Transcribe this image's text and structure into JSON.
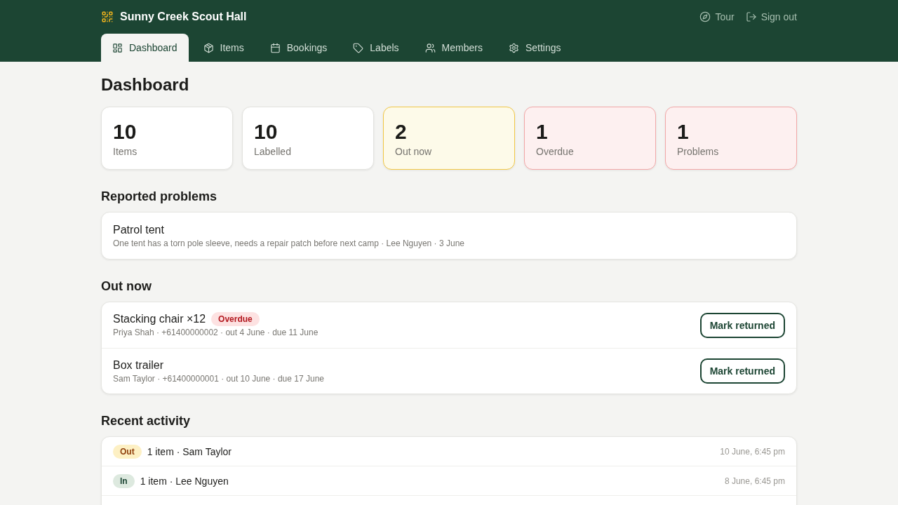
{
  "header": {
    "title": "Sunny Creek Scout Hall",
    "actions": [
      {
        "label": "Tour"
      },
      {
        "label": "Sign out"
      }
    ]
  },
  "tabs": [
    {
      "label": "Dashboard",
      "selected": true
    },
    {
      "label": "Items",
      "selected": false
    },
    {
      "label": "Bookings",
      "selected": false
    },
    {
      "label": "Labels",
      "selected": false
    },
    {
      "label": "Members",
      "selected": false
    },
    {
      "label": "Settings",
      "selected": false
    }
  ],
  "page_title": "Dashboard",
  "stats": [
    {
      "value": "10",
      "label": "Items",
      "kind": "neutral"
    },
    {
      "value": "10",
      "label": "Labelled",
      "kind": "neutral"
    },
    {
      "value": "2",
      "label": "Out now",
      "kind": "warning"
    },
    {
      "value": "1",
      "label": "Overdue",
      "kind": "alert"
    },
    {
      "value": "1",
      "label": "Problems",
      "kind": "alert"
    }
  ],
  "problems": {
    "heading": "Reported problems",
    "items": [
      {
        "title": "Patrol tent",
        "detail": "One tent has a torn pole sleeve, needs a repair patch before next camp · Lee Nguyen · 3 June"
      }
    ]
  },
  "out_now": {
    "heading": "Out now",
    "items": [
      {
        "title": "Stacking chair ×12",
        "badge": "Overdue",
        "detail": "Priya Shah · +61400000002 · out 4 June · due 11 June",
        "button": "Mark returned"
      },
      {
        "title": "Box trailer",
        "detail": "Sam Taylor · +61400000001 · out 10 June · due 17 June",
        "button": "Mark returned"
      }
    ]
  },
  "activity": {
    "heading": "Recent activity",
    "items": [
      {
        "kind": "out",
        "badge": "Out",
        "text": "1 item · Sam Taylor",
        "time": "10 June, 6:45 pm"
      },
      {
        "kind": "in",
        "badge": "In",
        "text": "1 item · Lee Nguyen",
        "time": "8 June, 6:45 pm"
      }
    ]
  }
}
